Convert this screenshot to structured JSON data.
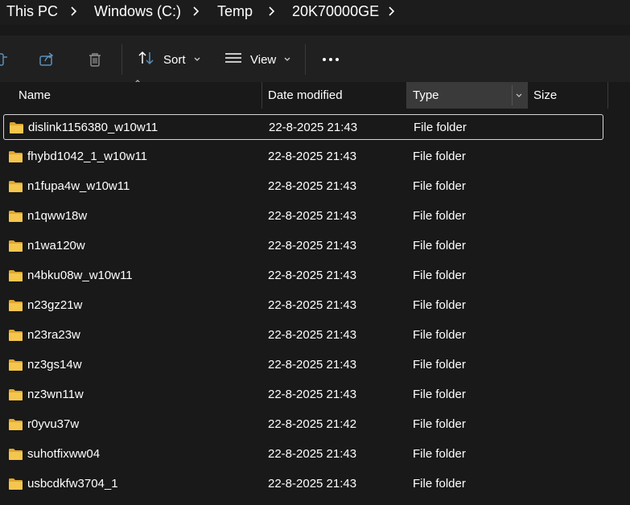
{
  "breadcrumb": {
    "items": [
      {
        "label": "This PC"
      },
      {
        "label": "Windows (C:)"
      },
      {
        "label": "Temp"
      },
      {
        "label": "20K70000GE"
      }
    ]
  },
  "commandbar": {
    "sort_label": "Sort",
    "view_label": "View",
    "icons": {
      "cut": "cut-icon",
      "share": "share-icon",
      "delete": "trash-icon",
      "sort": "sort-arrows-icon",
      "view": "view-lines-icon",
      "more": "more-dots-icon"
    }
  },
  "columns": {
    "name": "Name",
    "date": "Date modified",
    "type": "Type",
    "size": "Size",
    "sorted_by": "Name"
  },
  "files": [
    {
      "name": "dislink1156380_w10w11",
      "date": "22-8-2025 21:43",
      "type": "File folder",
      "selected": true
    },
    {
      "name": "fhybd1042_1_w10w11",
      "date": "22-8-2025 21:43",
      "type": "File folder"
    },
    {
      "name": "n1fupa4w_w10w11",
      "date": "22-8-2025 21:43",
      "type": "File folder"
    },
    {
      "name": "n1qww18w",
      "date": "22-8-2025 21:43",
      "type": "File folder"
    },
    {
      "name": "n1wa120w",
      "date": "22-8-2025 21:43",
      "type": "File folder"
    },
    {
      "name": "n4bku08w_w10w11",
      "date": "22-8-2025 21:43",
      "type": "File folder"
    },
    {
      "name": "n23gz21w",
      "date": "22-8-2025 21:43",
      "type": "File folder"
    },
    {
      "name": "n23ra23w",
      "date": "22-8-2025 21:43",
      "type": "File folder"
    },
    {
      "name": "nz3gs14w",
      "date": "22-8-2025 21:43",
      "type": "File folder"
    },
    {
      "name": "nz3wn11w",
      "date": "22-8-2025 21:43",
      "type": "File folder"
    },
    {
      "name": "r0yvu37w",
      "date": "22-8-2025 21:42",
      "type": "File folder"
    },
    {
      "name": "suhotfixww04",
      "date": "22-8-2025 21:43",
      "type": "File folder"
    },
    {
      "name": "usbcdkfw3704_1",
      "date": "22-8-2025 21:43",
      "type": "File folder"
    }
  ],
  "colors": {
    "background": "#191919",
    "toolbar": "#202020",
    "folder": "#f4c64e",
    "folder_dark": "#e0a82e",
    "text": "#ffffff",
    "selection_border": "#d6d6d6"
  }
}
